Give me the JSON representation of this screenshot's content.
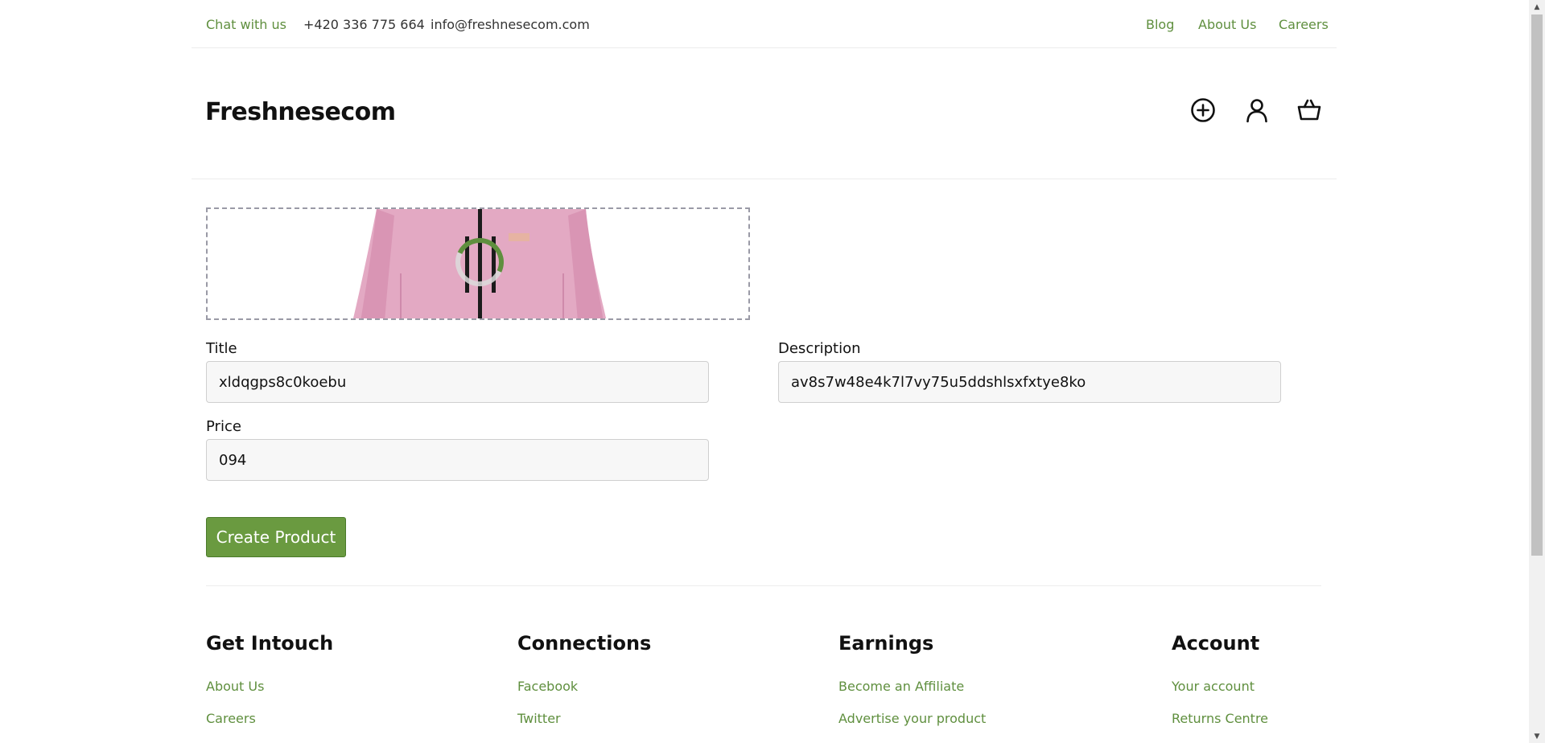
{
  "topbar": {
    "chat": "Chat with us",
    "phone": "+420 336 775 664",
    "email": "info@freshnesecom.com",
    "links": [
      "Blog",
      "About Us",
      "Careers"
    ]
  },
  "header": {
    "logo": "Freshnesecom",
    "icons": [
      "add-circle-icon",
      "user-icon",
      "basket-icon"
    ]
  },
  "upload": {
    "status": "uploading"
  },
  "form": {
    "title_label": "Title",
    "title_value": "xldqgps8c0koebu",
    "description_label": "Description",
    "description_value": "av8s7w48e4k7l7vy75u5ddshlsxfxtye8ko",
    "price_label": "Price",
    "price_value": "094",
    "submit_label": "Create Product"
  },
  "footer": {
    "columns": [
      {
        "title": "Get Intouch",
        "links": [
          "About Us",
          "Careers"
        ]
      },
      {
        "title": "Connections",
        "links": [
          "Facebook",
          "Twitter"
        ]
      },
      {
        "title": "Earnings",
        "links": [
          "Become an Affiliate",
          "Advertise your product"
        ]
      },
      {
        "title": "Account",
        "links": [
          "Your account",
          "Returns Centre"
        ]
      }
    ]
  },
  "colors": {
    "accent": "#5f8f3e",
    "button": "#6a9a40"
  }
}
